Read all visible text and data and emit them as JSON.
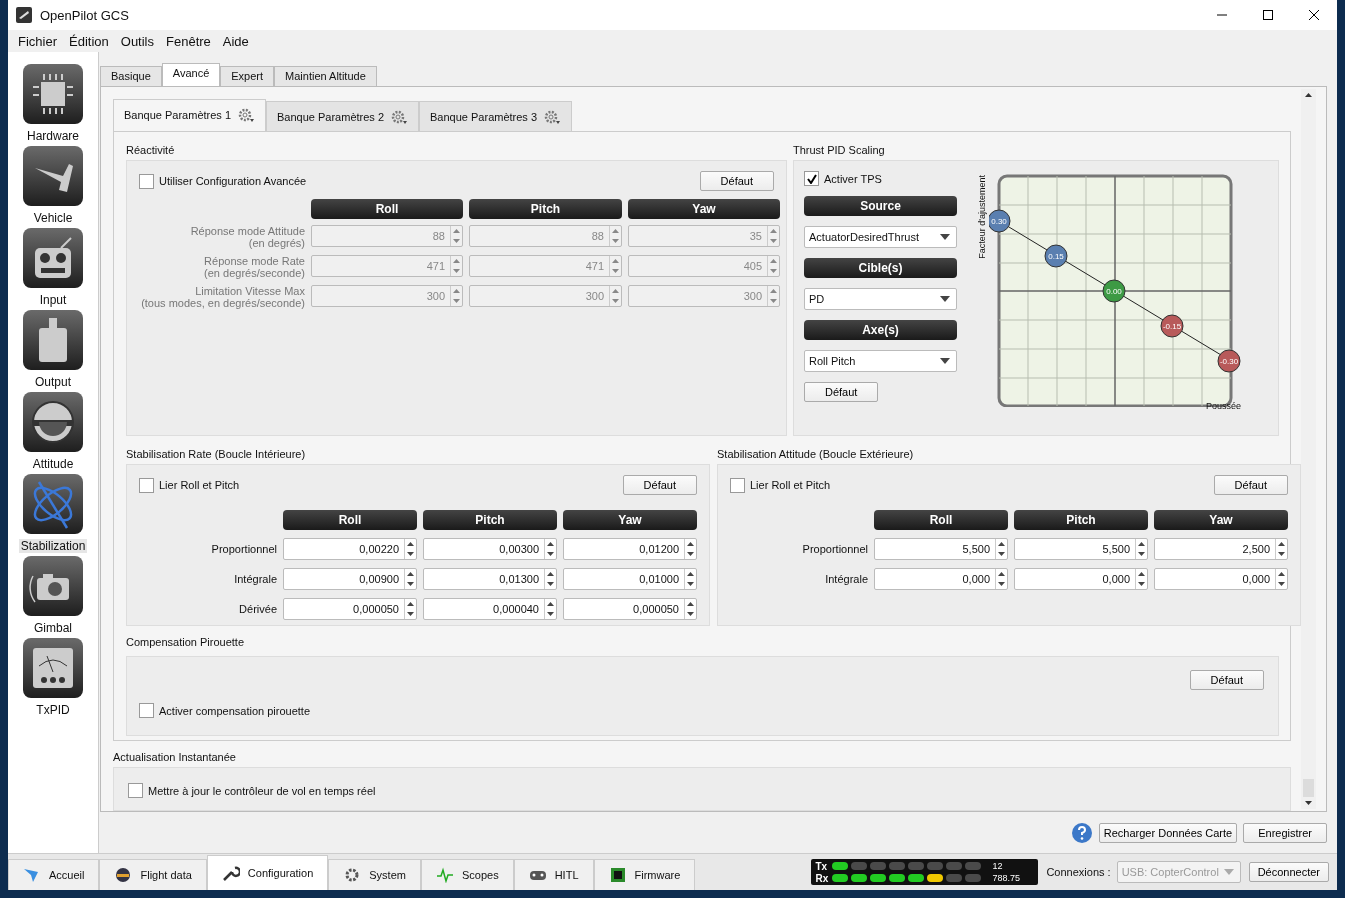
{
  "window": {
    "title": "OpenPilot GCS"
  },
  "menu": [
    {
      "label": "Fichier"
    },
    {
      "label": "Édition"
    },
    {
      "label": "Outils"
    },
    {
      "label": "Fenêtre"
    },
    {
      "label": "Aide"
    }
  ],
  "sidebar": {
    "items": [
      {
        "label": "Hardware",
        "selected": false
      },
      {
        "label": "Vehicle",
        "selected": false
      },
      {
        "label": "Input",
        "selected": false
      },
      {
        "label": "Output",
        "selected": false
      },
      {
        "label": "Attitude",
        "selected": false
      },
      {
        "label": "Stabilization",
        "selected": true
      },
      {
        "label": "Gimbal",
        "selected": false
      },
      {
        "label": "TxPID",
        "selected": false
      }
    ]
  },
  "tabs": [
    {
      "label": "Basique",
      "selected": false
    },
    {
      "label": "Avancé",
      "selected": true
    },
    {
      "label": "Expert",
      "selected": false
    },
    {
      "label": "Maintien Altitude",
      "selected": false
    }
  ],
  "bank_tabs": [
    {
      "label": "Banque Paramètres 1",
      "selected": true
    },
    {
      "label": "Banque Paramètres 2",
      "selected": false
    },
    {
      "label": "Banque Paramètres 3",
      "selected": false
    }
  ],
  "reactivity": {
    "title": "Réactivité",
    "advanced": {
      "label": "Utiliser Configuration Avancée",
      "checked": false
    },
    "default_button": "Défaut",
    "columns": [
      "Roll",
      "Pitch",
      "Yaw"
    ],
    "rows": [
      {
        "label": "Réponse mode Attitude",
        "sublabel": "(en degrés)",
        "values": [
          "88",
          "88",
          "35"
        ]
      },
      {
        "label": "Réponse mode Rate",
        "sublabel": "(en degrés/seconde)",
        "values": [
          "471",
          "471",
          "405"
        ]
      },
      {
        "label": "Limitation Vitesse Max",
        "sublabel": "(tous modes, en degrés/seconde)",
        "values": [
          "300",
          "300",
          "300"
        ]
      }
    ]
  },
  "thrust": {
    "title": "Thrust PID Scaling",
    "enable": {
      "label": "Activer TPS",
      "checked": true
    },
    "source_header": "Source",
    "source_value": "ActuatorDesiredThrust",
    "target_header": "Cible(s)",
    "target_value": "PD",
    "axis_header": "Axe(s)",
    "axis_value": "Roll Pitch",
    "default_button": "Défaut",
    "graph": {
      "ylabel": "Facteur d'ajustement",
      "xlabel": "Poussée",
      "points": [
        {
          "label": "0.30",
          "color": "#5a7fb0"
        },
        {
          "label": "0.15",
          "color": "#5a7fb0"
        },
        {
          "label": "0.00",
          "color": "#3d9a44"
        },
        {
          "label": "-0.15",
          "color": "#b85a5a"
        },
        {
          "label": "-0.30",
          "color": "#b85a5a"
        }
      ]
    }
  },
  "rate": {
    "title": "Stabilisation Rate (Boucle Intérieure)",
    "link": {
      "label": "Lier Roll et Pitch",
      "checked": false
    },
    "default_button": "Défaut",
    "columns": [
      "Roll",
      "Pitch",
      "Yaw"
    ],
    "rows": [
      {
        "label": "Proportionnel",
        "values": [
          "0,00220",
          "0,00300",
          "0,01200"
        ]
      },
      {
        "label": "Intégrale",
        "values": [
          "0,00900",
          "0,01300",
          "0,01000"
        ]
      },
      {
        "label": "Dérivée",
        "values": [
          "0,000050",
          "0,000040",
          "0,000050"
        ]
      }
    ]
  },
  "attitude": {
    "title": "Stabilisation Attitude (Boucle Extérieure)",
    "link": {
      "label": "Lier Roll et Pitch",
      "checked": false
    },
    "default_button": "Défaut",
    "columns": [
      "Roll",
      "Pitch",
      "Yaw"
    ],
    "rows": [
      {
        "label": "Proportionnel",
        "values": [
          "5,500",
          "5,500",
          "2,500"
        ]
      },
      {
        "label": "Intégrale",
        "values": [
          "0,000",
          "0,000",
          "0,000"
        ]
      }
    ]
  },
  "pirouette": {
    "title": "Compensation Pirouette",
    "default_button": "Défaut",
    "enable": {
      "label": "Activer compensation pirouette",
      "checked": false
    }
  },
  "instant": {
    "title": "Actualisation Instantanée",
    "update": {
      "label": "Mettre à jour le contrôleur de vol en temps réel",
      "checked": false
    }
  },
  "footer": {
    "reload_button": "Recharger Données Carte",
    "save_button": "Enregistrer"
  },
  "modes": [
    {
      "label": "Accueil",
      "selected": false
    },
    {
      "label": "Flight data",
      "selected": false
    },
    {
      "label": "Configuration",
      "selected": true
    },
    {
      "label": "System",
      "selected": false
    },
    {
      "label": "Scopes",
      "selected": false
    },
    {
      "label": "HITL",
      "selected": false
    },
    {
      "label": "Firmware",
      "selected": false
    }
  ],
  "telemetry": {
    "tx_label": "Tx",
    "rx_label": "Rx",
    "tx_value": "12",
    "rx_value": "788.75",
    "tx_leds": [
      {
        "color": "#22cc22"
      },
      {
        "color": "#4a4a4a"
      },
      {
        "color": "#4a4a4a"
      },
      {
        "color": "#4a4a4a"
      },
      {
        "color": "#4a4a4a"
      },
      {
        "color": "#4a4a4a"
      },
      {
        "color": "#4a4a4a"
      },
      {
        "color": "#4a4a4a"
      }
    ],
    "rx_leds": [
      {
        "color": "#22cc22"
      },
      {
        "color": "#22cc22"
      },
      {
        "color": "#22cc22"
      },
      {
        "color": "#22cc22"
      },
      {
        "color": "#22cc22"
      },
      {
        "color": "#f0c800"
      },
      {
        "color": "#4a4a4a"
      },
      {
        "color": "#4a4a4a"
      }
    ]
  },
  "connection": {
    "label": "Connexions :",
    "value": "USB: CopterControl",
    "disabled": true,
    "disconnect_button": "Déconnecter"
  }
}
